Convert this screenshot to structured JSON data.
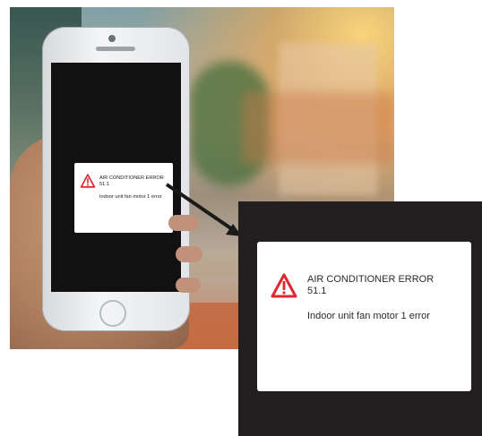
{
  "error_dialog": {
    "title_line1": "AIR CONDITIONER ERROR",
    "title_line2": "51.1",
    "message": "Indoor unit fan motor 1 error"
  },
  "icons": {
    "warning": "warning-triangle-icon"
  },
  "colors": {
    "warning_red": "#e0262e",
    "zoom_background": "#231f20",
    "dialog_background": "#ffffff"
  }
}
